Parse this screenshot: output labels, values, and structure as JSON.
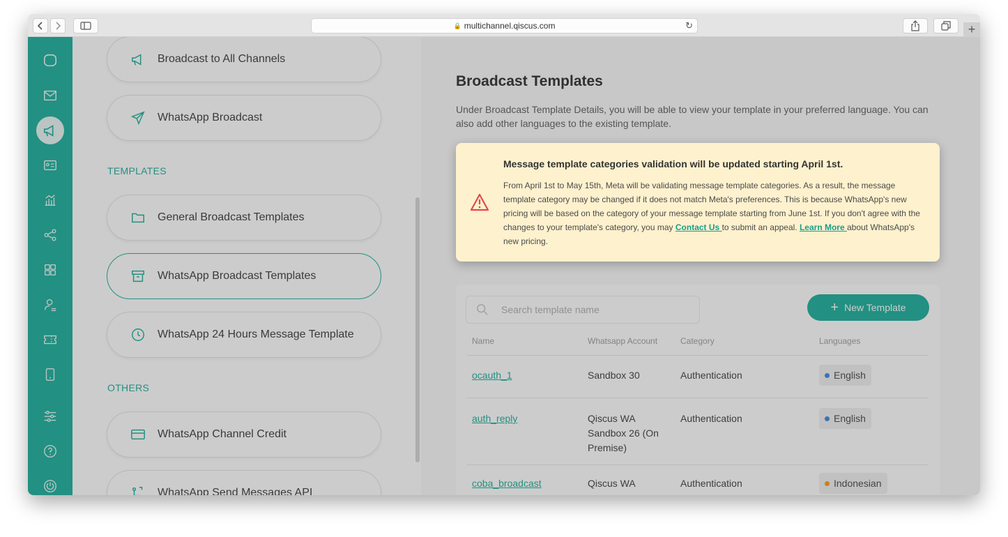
{
  "browser": {
    "url": "multichannel.qiscus.com"
  },
  "rail": {
    "items": [
      {
        "name": "chat-icon"
      },
      {
        "name": "mail-icon"
      },
      {
        "name": "megaphone-icon",
        "active": true
      },
      {
        "name": "contact-card-icon"
      },
      {
        "name": "analytics-icon"
      },
      {
        "name": "share-icon"
      },
      {
        "name": "apps-icon"
      },
      {
        "name": "agent-icon"
      },
      {
        "name": "ticket-icon"
      },
      {
        "name": "mobile-icon"
      },
      {
        "name": "settings-sliders-icon"
      },
      {
        "name": "help-icon"
      },
      {
        "name": "power-icon"
      }
    ]
  },
  "sidebar": {
    "broadcast_all": "Broadcast to All Channels",
    "whatsapp_broadcast": "WhatsApp Broadcast",
    "templates_label": "TEMPLATES",
    "general_templates": "General Broadcast Templates",
    "wa_broadcast_templates": "WhatsApp Broadcast Templates",
    "wa_24h_template": "WhatsApp 24 Hours Message Template",
    "others_label": "OTHERS",
    "wa_channel_credit": "WhatsApp Channel Credit",
    "wa_send_api": "WhatsApp Send Messages API"
  },
  "main": {
    "title": "Broadcast Templates",
    "description": "Under Broadcast Template Details, you will be able to view your template in your preferred language. You can also add other languages to the existing template."
  },
  "alert": {
    "title": "Message template categories validation will be updated starting April 1st.",
    "body_1": "From April 1st to May 15th, Meta will be validating message template categories. As a result, the message template category may be changed if it does not match Meta's preferences. This is because WhatsApp's new pricing will be based on the category of your message template starting from June 1st. If you don't agree with the changes to your template's category, you may ",
    "contact_link": "Contact Us ",
    "body_2": "to submit an appeal. ",
    "learn_link": "Learn More ",
    "body_3": "about WhatsApp's new pricing."
  },
  "search": {
    "placeholder": "Search template name"
  },
  "new_template_label": "New Template",
  "table": {
    "headers": [
      "Name",
      "Whatsapp Account",
      "Category",
      "Languages"
    ],
    "rows": [
      {
        "name": "ocauth_1",
        "account": "Sandbox 30",
        "category": "Authentication",
        "language": "English",
        "lang_color": "#4a90e2"
      },
      {
        "name": "auth_reply",
        "account": "Qiscus WA Sandbox 26 (On Premise)",
        "category": "Authentication",
        "language": "English",
        "lang_color": "#4a90e2"
      },
      {
        "name": "coba_broadcast",
        "account": "Qiscus WA",
        "category": "Authentication",
        "language": "Indonesian",
        "lang_color": "#f5a623"
      }
    ]
  }
}
